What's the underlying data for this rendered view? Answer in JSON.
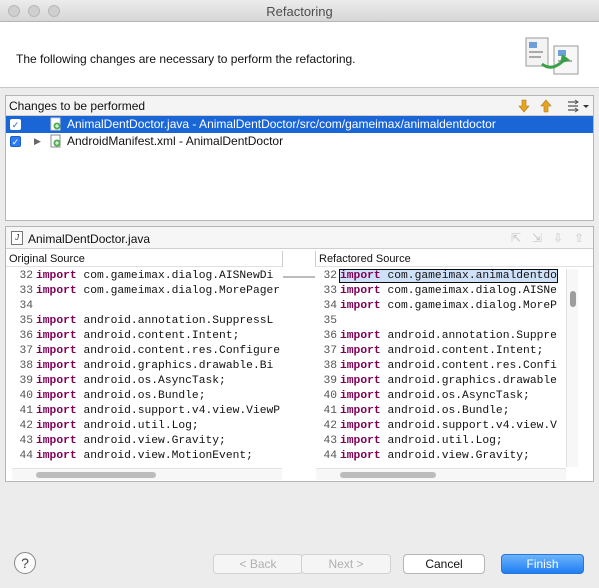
{
  "window": {
    "title": "Refactoring"
  },
  "banner": {
    "message": "The following changes are necessary to perform the refactoring."
  },
  "changes": {
    "title": "Changes to be performed",
    "items": [
      {
        "label": "AnimalDentDoctor.java - AnimalDentDoctor/src/com/gameimax/animaldentdoctor",
        "checked": true,
        "selected": true
      },
      {
        "label": "AndroidManifest.xml - AnimalDentDoctor",
        "checked": true,
        "selected": false
      }
    ]
  },
  "compare": {
    "file_title": "AnimalDentDoctor.java",
    "original_label": "Original Source",
    "refactored_label": "Refactored Source",
    "original_lines": [
      {
        "n": "32",
        "kw": "import",
        "rest": " com.gameimax.dialog.AISNewDi"
      },
      {
        "n": "33",
        "kw": "import",
        "rest": " com.gameimax.dialog.MorePager"
      },
      {
        "n": "34",
        "kw": "",
        "rest": ""
      },
      {
        "n": "35",
        "kw": "import",
        "rest": " android.annotation.SuppressL"
      },
      {
        "n": "36",
        "kw": "import",
        "rest": " android.content.Intent;"
      },
      {
        "n": "37",
        "kw": "import",
        "rest": " android.content.res.Configure"
      },
      {
        "n": "38",
        "kw": "import",
        "rest": " android.graphics.drawable.Bi"
      },
      {
        "n": "39",
        "kw": "import",
        "rest": " android.os.AsyncTask;"
      },
      {
        "n": "40",
        "kw": "import",
        "rest": " android.os.Bundle;"
      },
      {
        "n": "41",
        "kw": "import",
        "rest": " android.support.v4.view.ViewP"
      },
      {
        "n": "42",
        "kw": "import",
        "rest": " android.util.Log;"
      },
      {
        "n": "43",
        "kw": "import",
        "rest": " android.view.Gravity;"
      },
      {
        "n": "44",
        "kw": "import",
        "rest": " android.view.MotionEvent;"
      }
    ],
    "refactored_lines": [
      {
        "n": "32",
        "kw": "import",
        "rest": " com.gameimax.animaldentdo"
      },
      {
        "n": "33",
        "kw": "import",
        "rest": " com.gameimax.dialog.AISNe"
      },
      {
        "n": "34",
        "kw": "import",
        "rest": " com.gameimax.dialog.MoreP"
      },
      {
        "n": "35",
        "kw": "",
        "rest": ""
      },
      {
        "n": "36",
        "kw": "import",
        "rest": " android.annotation.Suppre"
      },
      {
        "n": "37",
        "kw": "import",
        "rest": " android.content.Intent;"
      },
      {
        "n": "38",
        "kw": "import",
        "rest": " android.content.res.Confi"
      },
      {
        "n": "39",
        "kw": "import",
        "rest": " android.graphics.drawable"
      },
      {
        "n": "40",
        "kw": "import",
        "rest": " android.os.AsyncTask;"
      },
      {
        "n": "41",
        "kw": "import",
        "rest": " android.os.Bundle;"
      },
      {
        "n": "42",
        "kw": "import",
        "rest": " android.support.v4.view.V"
      },
      {
        "n": "43",
        "kw": "import",
        "rest": " android.util.Log;"
      },
      {
        "n": "44",
        "kw": "import",
        "rest": " android.view.Gravity;"
      }
    ]
  },
  "buttons": {
    "help": "?",
    "back": "< Back",
    "next": "Next >",
    "cancel": "Cancel",
    "finish": "Finish"
  },
  "colors": {
    "selection": "#1b66d6",
    "keyword": "#7f0055",
    "primary_button": "#1f7df4"
  }
}
